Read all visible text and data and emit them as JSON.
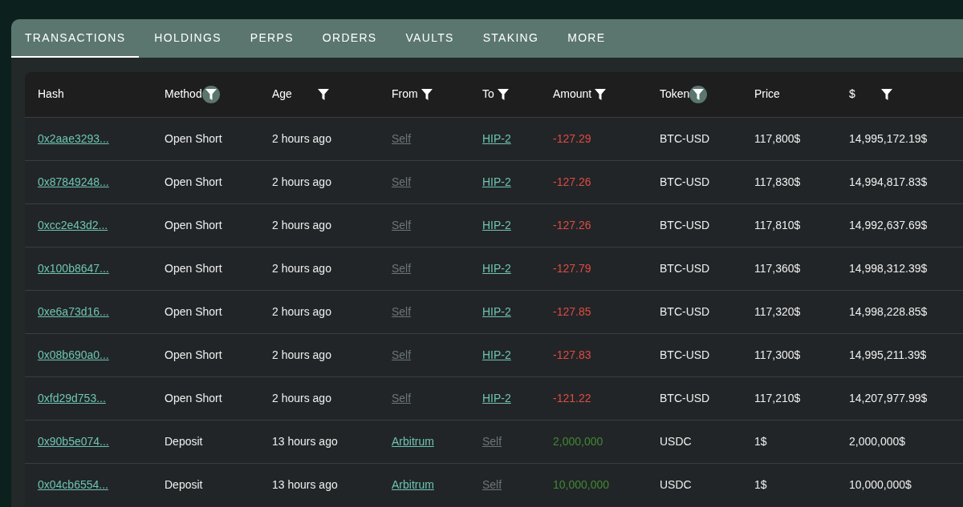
{
  "tabs": [
    {
      "label": "TRANSACTIONS",
      "selected": true
    },
    {
      "label": "HOLDINGS",
      "selected": false
    },
    {
      "label": "PERPS",
      "selected": false
    },
    {
      "label": "ORDERS",
      "selected": false
    },
    {
      "label": "VAULTS",
      "selected": false
    },
    {
      "label": "STAKING",
      "selected": false
    },
    {
      "label": "MORE",
      "selected": false
    }
  ],
  "table": {
    "columns": [
      {
        "label": "Hash",
        "filterable": false
      },
      {
        "label": "Method",
        "filterable": true,
        "filter_active": true
      },
      {
        "label": "Age",
        "filterable": true,
        "filter_active": false
      },
      {
        "label": "From",
        "filterable": true,
        "filter_active": false
      },
      {
        "label": "To",
        "filterable": true,
        "filter_active": false
      },
      {
        "label": "Amount",
        "filterable": true,
        "filter_active": false
      },
      {
        "label": "Token",
        "filterable": true,
        "filter_active": true
      },
      {
        "label": "Price",
        "filterable": false
      },
      {
        "label": "$",
        "filterable": true,
        "filter_active": false
      }
    ],
    "rows": [
      {
        "hash": "0x2aae3293...",
        "method": "Open Short",
        "age": "2 hours ago",
        "from": {
          "text": "Self",
          "kind": "self"
        },
        "to": {
          "text": "HIP-2",
          "kind": "link"
        },
        "amount": {
          "text": "-127.29",
          "kind": "debit"
        },
        "token": "BTC-USD",
        "price": "117,800$",
        "usd": "14,995,172.19$"
      },
      {
        "hash": "0x87849248...",
        "method": "Open Short",
        "age": "2 hours ago",
        "from": {
          "text": "Self",
          "kind": "self"
        },
        "to": {
          "text": "HIP-2",
          "kind": "link"
        },
        "amount": {
          "text": "-127.26",
          "kind": "debit"
        },
        "token": "BTC-USD",
        "price": "117,830$",
        "usd": "14,994,817.83$"
      },
      {
        "hash": "0xcc2e43d2...",
        "method": "Open Short",
        "age": "2 hours ago",
        "from": {
          "text": "Self",
          "kind": "self"
        },
        "to": {
          "text": "HIP-2",
          "kind": "link"
        },
        "amount": {
          "text": "-127.26",
          "kind": "debit"
        },
        "token": "BTC-USD",
        "price": "117,810$",
        "usd": "14,992,637.69$"
      },
      {
        "hash": "0x100b8647...",
        "method": "Open Short",
        "age": "2 hours ago",
        "from": {
          "text": "Self",
          "kind": "self"
        },
        "to": {
          "text": "HIP-2",
          "kind": "link"
        },
        "amount": {
          "text": "-127.79",
          "kind": "debit"
        },
        "token": "BTC-USD",
        "price": "117,360$",
        "usd": "14,998,312.39$"
      },
      {
        "hash": "0xe6a73d16...",
        "method": "Open Short",
        "age": "2 hours ago",
        "from": {
          "text": "Self",
          "kind": "self"
        },
        "to": {
          "text": "HIP-2",
          "kind": "link"
        },
        "amount": {
          "text": "-127.85",
          "kind": "debit"
        },
        "token": "BTC-USD",
        "price": "117,320$",
        "usd": "14,998,228.85$"
      },
      {
        "hash": "0x08b690a0...",
        "method": "Open Short",
        "age": "2 hours ago",
        "from": {
          "text": "Self",
          "kind": "self"
        },
        "to": {
          "text": "HIP-2",
          "kind": "link"
        },
        "amount": {
          "text": "-127.83",
          "kind": "debit"
        },
        "token": "BTC-USD",
        "price": "117,300$",
        "usd": "14,995,211.39$"
      },
      {
        "hash": "0xfd29d753...",
        "method": "Open Short",
        "age": "2 hours ago",
        "from": {
          "text": "Self",
          "kind": "self"
        },
        "to": {
          "text": "HIP-2",
          "kind": "link"
        },
        "amount": {
          "text": "-121.22",
          "kind": "debit"
        },
        "token": "BTC-USD",
        "price": "117,210$",
        "usd": "14,207,977.99$"
      },
      {
        "hash": "0x90b5e074...",
        "method": "Deposit",
        "age": "13 hours ago",
        "from": {
          "text": "Arbitrum",
          "kind": "link"
        },
        "to": {
          "text": "Self",
          "kind": "self"
        },
        "amount": {
          "text": "2,000,000",
          "kind": "credit"
        },
        "token": "USDC",
        "price": "1$",
        "usd": "2,000,000$"
      },
      {
        "hash": "0x04cb6554...",
        "method": "Deposit",
        "age": "13 hours ago",
        "from": {
          "text": "Arbitrum",
          "kind": "link"
        },
        "to": {
          "text": "Self",
          "kind": "self"
        },
        "amount": {
          "text": "10,000,000",
          "kind": "credit"
        },
        "token": "USDC",
        "price": "1$",
        "usd": "10,000,000$"
      }
    ]
  }
}
